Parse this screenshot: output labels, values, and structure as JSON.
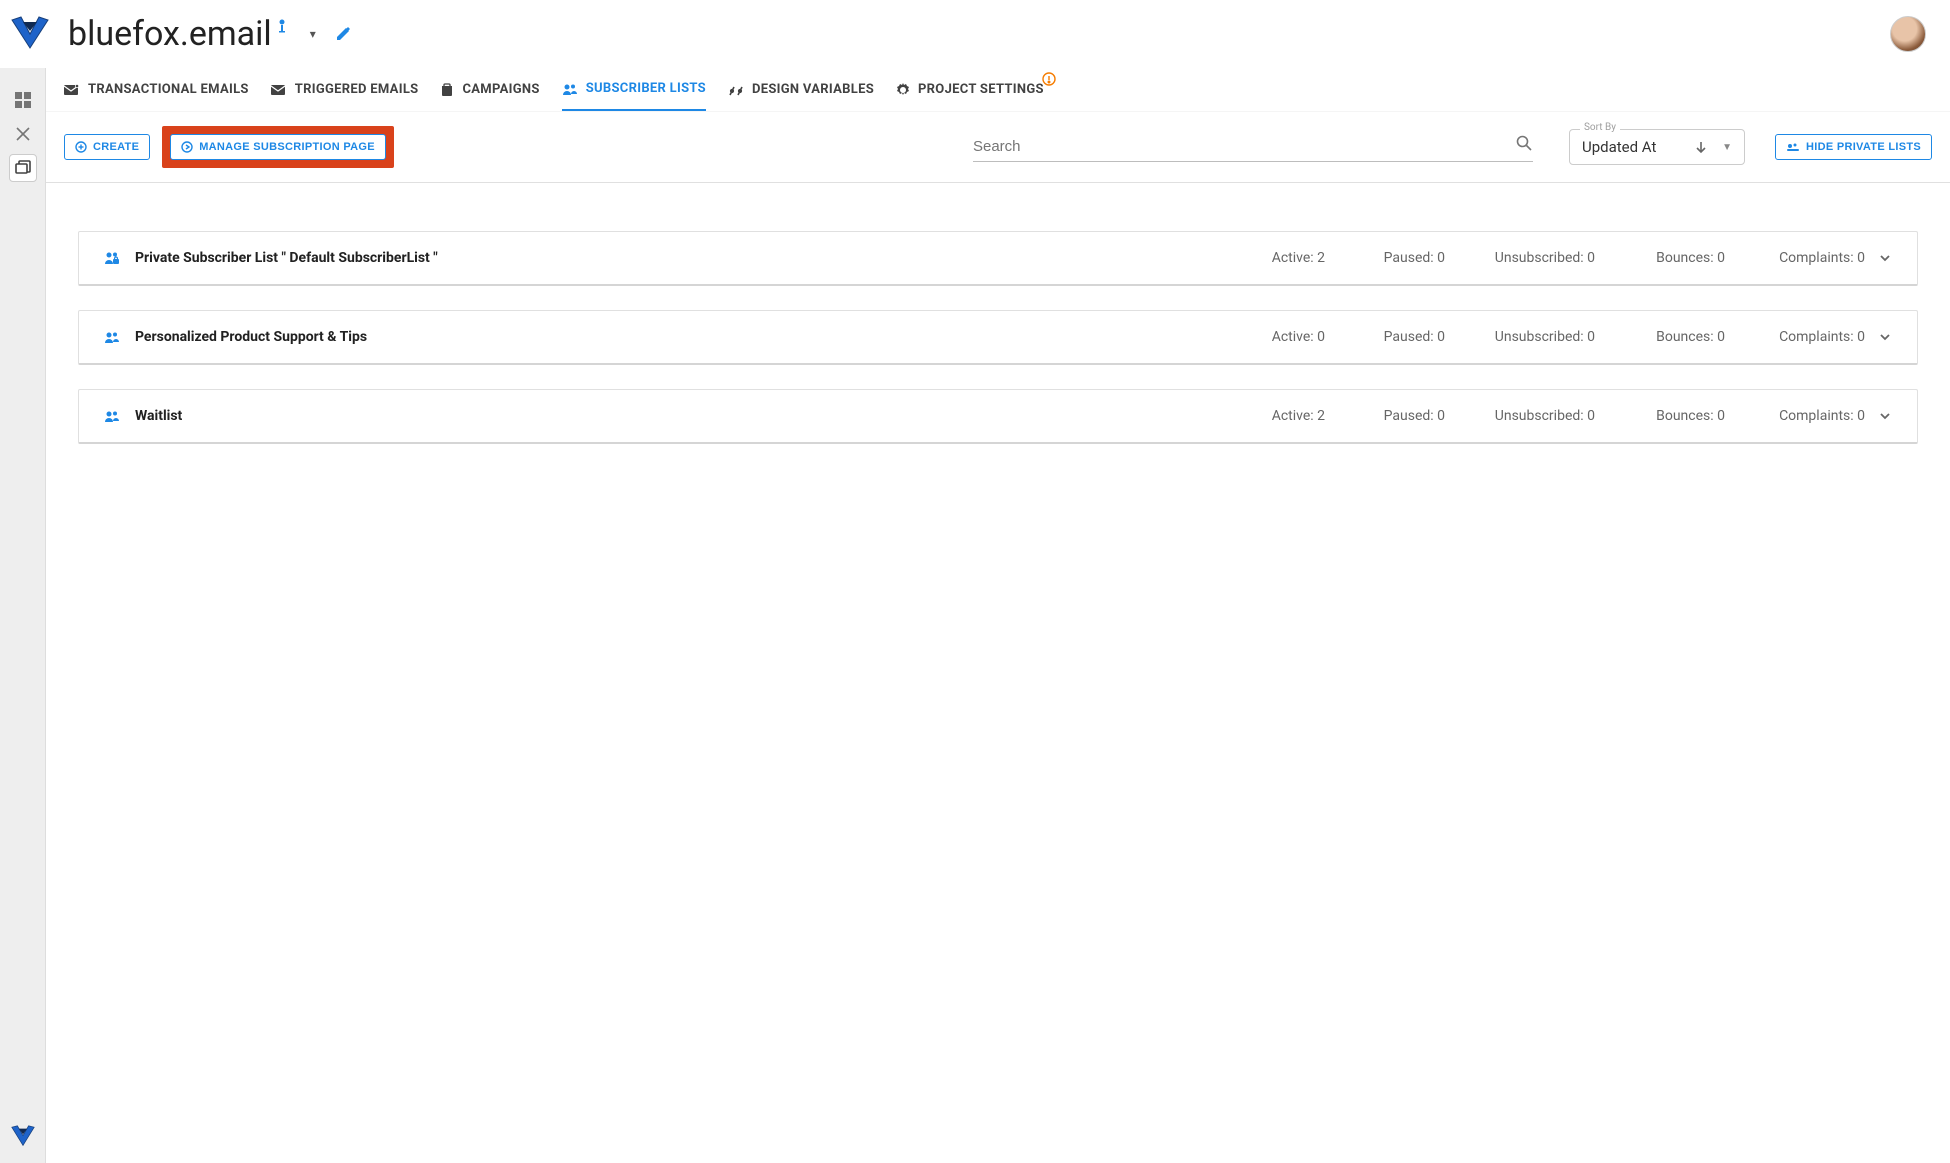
{
  "brand": {
    "name": "bluefox.email"
  },
  "tabs": [
    {
      "label": "Transactional Emails"
    },
    {
      "label": "Triggered Emails"
    },
    {
      "label": "Campaigns"
    },
    {
      "label": "Subscriber Lists",
      "active": true
    },
    {
      "label": "Design Variables"
    },
    {
      "label": "Project Settings",
      "alert": true
    }
  ],
  "actions": {
    "create_label": "CREATE",
    "manage_label": "MANAGE SUBSCRIPTION PAGE",
    "hide_private_label": "HIDE PRIVATE LISTS"
  },
  "search": {
    "placeholder": "Search",
    "value": ""
  },
  "sort": {
    "label": "Sort By",
    "value": "Updated At"
  },
  "stat_labels": {
    "active": "Active",
    "paused": "Paused",
    "unsubscribed": "Unsubscribed",
    "bounces": "Bounces",
    "complaints": "Complaints"
  },
  "lists": [
    {
      "icon": "private",
      "name": "Private Subscriber List \" Default SubscriberList \"",
      "active": 2,
      "paused": 0,
      "unsubscribed": 0,
      "bounces": 0,
      "complaints": 0
    },
    {
      "icon": "group",
      "name": "Personalized Product Support & Tips",
      "active": 0,
      "paused": 0,
      "unsubscribed": 0,
      "bounces": 0,
      "complaints": 0
    },
    {
      "icon": "group",
      "name": "Waitlist",
      "active": 2,
      "paused": 0,
      "unsubscribed": 0,
      "bounces": 0,
      "complaints": 0
    }
  ]
}
